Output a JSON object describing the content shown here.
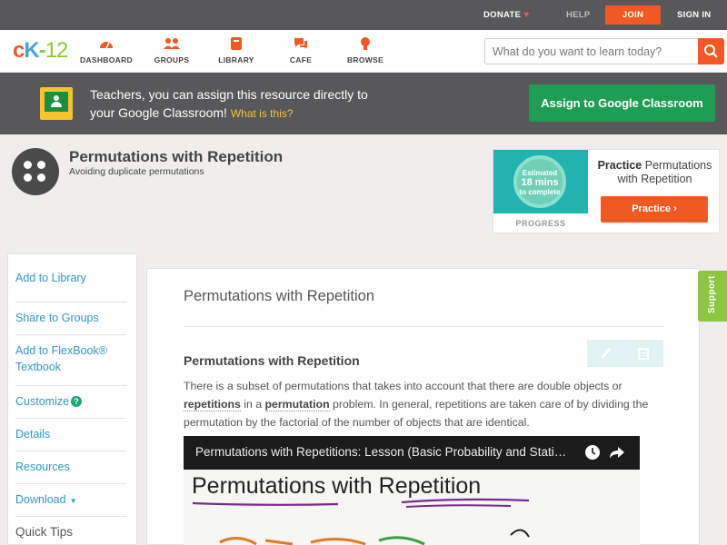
{
  "topbar": {
    "donate": "DONATE",
    "help": "HELP",
    "join": "JOIN",
    "signin": "SIGN IN"
  },
  "logo": {
    "c": "c",
    "k": "K",
    "dash": "-",
    "n": "12"
  },
  "nav": {
    "dashboard": "DASHBOARD",
    "groups": "GROUPS",
    "library": "LIBRARY",
    "cafe": "CAFE",
    "browse": "BROWSE"
  },
  "search": {
    "placeholder": "What do you want to learn today?"
  },
  "teacher_banner": {
    "line1": "Teachers, you can assign this resource directly to",
    "line2": "your Google Classroom!",
    "what_link": "What is this?",
    "assign_button": "Assign to Google Classroom"
  },
  "header": {
    "title": "Permutations with Repetition",
    "subtitle": "Avoiding duplicate permutations"
  },
  "practice": {
    "estimated": "Estimated",
    "mins": "18 mins",
    "to_complete": "to complete",
    "progress_label": "PROGRESS",
    "title_bold": "Practice",
    "title_rest": "Permutations with Repetition",
    "button": "Practice"
  },
  "sidebar": {
    "add_library": "Add to Library",
    "share_groups": "Share to Groups",
    "add_flexbook": "Add to FlexBook®",
    "textbook": "Textbook",
    "customize": "Customize",
    "details": "Details",
    "resources": "Resources",
    "download": "Download",
    "quick_tips": "Quick Tips"
  },
  "content": {
    "title": "Permutations with Repetition",
    "section_heading": "Permutations with Repetition",
    "para_part1": "There is a subset of permutations that takes into account that there are double objects or",
    "kw_repetitions": "repetitions",
    "para_in_a": "in a",
    "kw_permutation": "permutation",
    "para_part2": "problem. In general, repetitions are taken care of by dividing the permutation by the factorial of the number of objects that are identical."
  },
  "video": {
    "title": "Permutations with Repetitions: Lesson (Basic Probability and Stati…",
    "board_text": "Permutations with Repetition"
  },
  "support": {
    "label": "Support"
  },
  "colors": {
    "brand_orange": "#f05a22",
    "brand_green": "#8dc63f",
    "google_green": "#1e9e52",
    "link_blue": "#3097c7"
  }
}
